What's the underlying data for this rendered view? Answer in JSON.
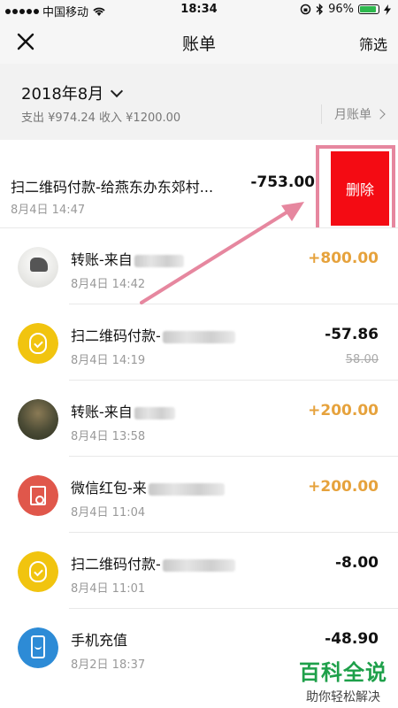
{
  "status_bar": {
    "carrier": "中国移动",
    "time": "18:34",
    "battery": "96%"
  },
  "nav": {
    "title": "账单",
    "filter_label": "筛选"
  },
  "summary": {
    "month": "2018年8月",
    "totals": "支出 ¥974.24 收入 ¥1200.00",
    "month_bill_label": "月账单"
  },
  "swiped": {
    "title": "扫二维码付款-给燕东办东郊村...",
    "date": "8月4日 14:47",
    "amount": "-753.00",
    "delete_label": "删除"
  },
  "transactions": [
    {
      "title": "转账-来自",
      "date": "8月4日 14:42",
      "amount": "+800.00",
      "icon": "photo-horse"
    },
    {
      "title": "扫二维码付款-",
      "date": "8月4日 14:19",
      "amount": "-57.86",
      "original": "58.00",
      "icon": "coin-bag"
    },
    {
      "title": "转账-来自",
      "date": "8月4日 13:58",
      "amount": "+200.00",
      "icon": "photo-man"
    },
    {
      "title": "微信红包-来",
      "date": "8月4日 11:04",
      "amount": "+200.00",
      "icon": "red-envelope"
    },
    {
      "title": "扫二维码付款-",
      "date": "8月4日 11:01",
      "amount": "-8.00",
      "icon": "coin-bag"
    },
    {
      "title": "手机充值",
      "date": "8月2日 18:37",
      "amount": "-48.90",
      "icon": "phone"
    }
  ],
  "watermark": {
    "main": "百科全说",
    "sub": "助你轻松解决"
  },
  "colors": {
    "delete": "#f40b13",
    "income": "#e6a23c",
    "annotation": "#e6879f"
  }
}
